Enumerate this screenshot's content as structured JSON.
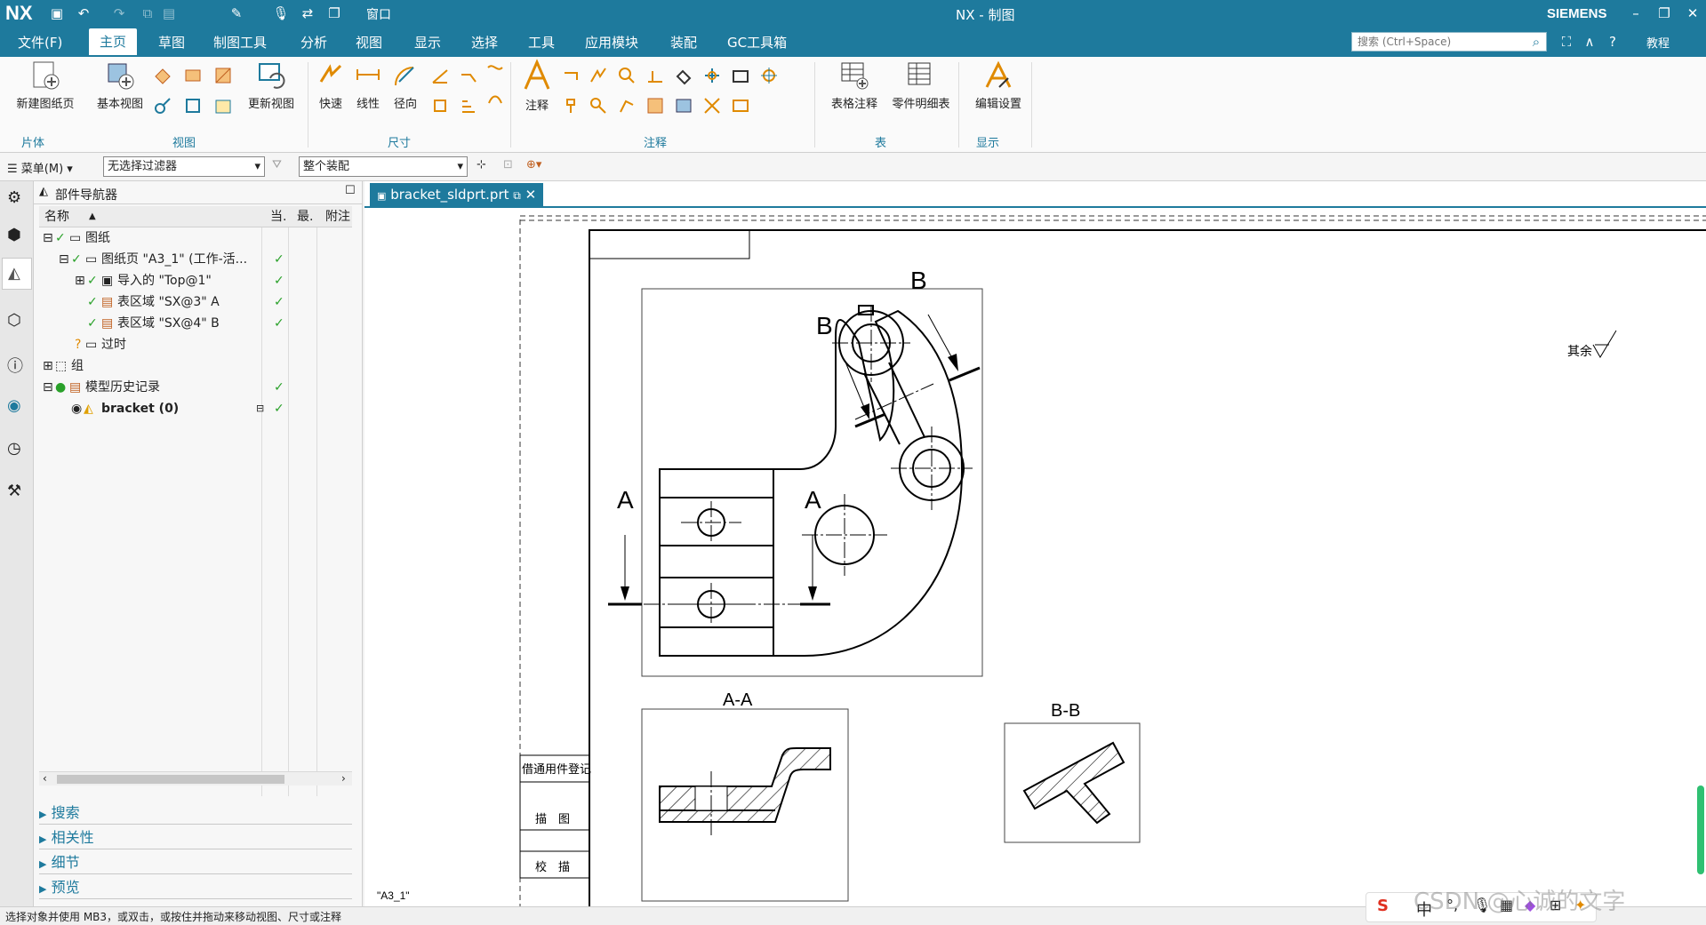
{
  "app": {
    "logo": "NX",
    "title": "NX - 制图",
    "brand": "SIEMENS",
    "search_placeholder": "搜索 (Ctrl+Space)",
    "help_label": "教程",
    "window_label": "窗口",
    "accent": "#1e7a9d"
  },
  "menu": {
    "items": [
      "文件(F)",
      "主页",
      "草图",
      "制图工具",
      "分析",
      "视图",
      "显示",
      "选择",
      "工具",
      "应用模块",
      "装配",
      "GC工具箱"
    ],
    "active": "主页"
  },
  "ribbon": {
    "new_sheet": "新建图纸页",
    "base_view": "基本视图",
    "update_view": "更新视图",
    "quick": "快速",
    "linear": "线性",
    "radial": "径向",
    "annotation": "注释",
    "table_note": "表格注释",
    "parts_list": "零件明细表",
    "edit_settings": "编辑设置",
    "groups": {
      "sheet": "片体",
      "view": "视图",
      "dimension": "尺寸",
      "annotation": "注释",
      "table": "表",
      "display": "显示"
    }
  },
  "toolbar2": {
    "menu": "菜单(M)",
    "filter": "无选择过滤器",
    "assembly": "整个装配"
  },
  "navigator": {
    "title": "部件导航器",
    "columns": [
      "名称",
      "当.",
      "最.",
      "附注"
    ],
    "rows": [
      {
        "label": "图纸",
        "check": ""
      },
      {
        "label": "图纸页 \"A3_1\" (工作-活...",
        "check": "✓"
      },
      {
        "label": "导入的 \"Top@1\"",
        "check": "✓"
      },
      {
        "label": "表区域 \"SX@3\" A",
        "check": "✓"
      },
      {
        "label": "表区域 \"SX@4\" B",
        "check": "✓"
      },
      {
        "label": "过时",
        "check": ""
      },
      {
        "label": "组",
        "check": ""
      },
      {
        "label": "模型历史记录",
        "check": "✓"
      },
      {
        "label": "bracket (0)",
        "check": "✓"
      }
    ],
    "accordion": [
      "搜索",
      "相关性",
      "细节",
      "预览"
    ]
  },
  "document": {
    "tab": "bracket_sldprt.prt",
    "sheet_label": "\"A3_1\"",
    "section_A": "A",
    "section_B": "B",
    "view_AA": "A-A",
    "view_BB": "B-B",
    "title_cell_1": "借通用件登记",
    "title_cell_2": "描　图",
    "title_cell_3": "校　描",
    "roughness": "其余"
  },
  "status": {
    "text": "选择对象并使用 MB3，或双击，或按住并拖动来移动视图、尺寸或注释"
  },
  "ime": {
    "chinese": "中",
    "watermark": "CSDN @心诚的文字"
  }
}
